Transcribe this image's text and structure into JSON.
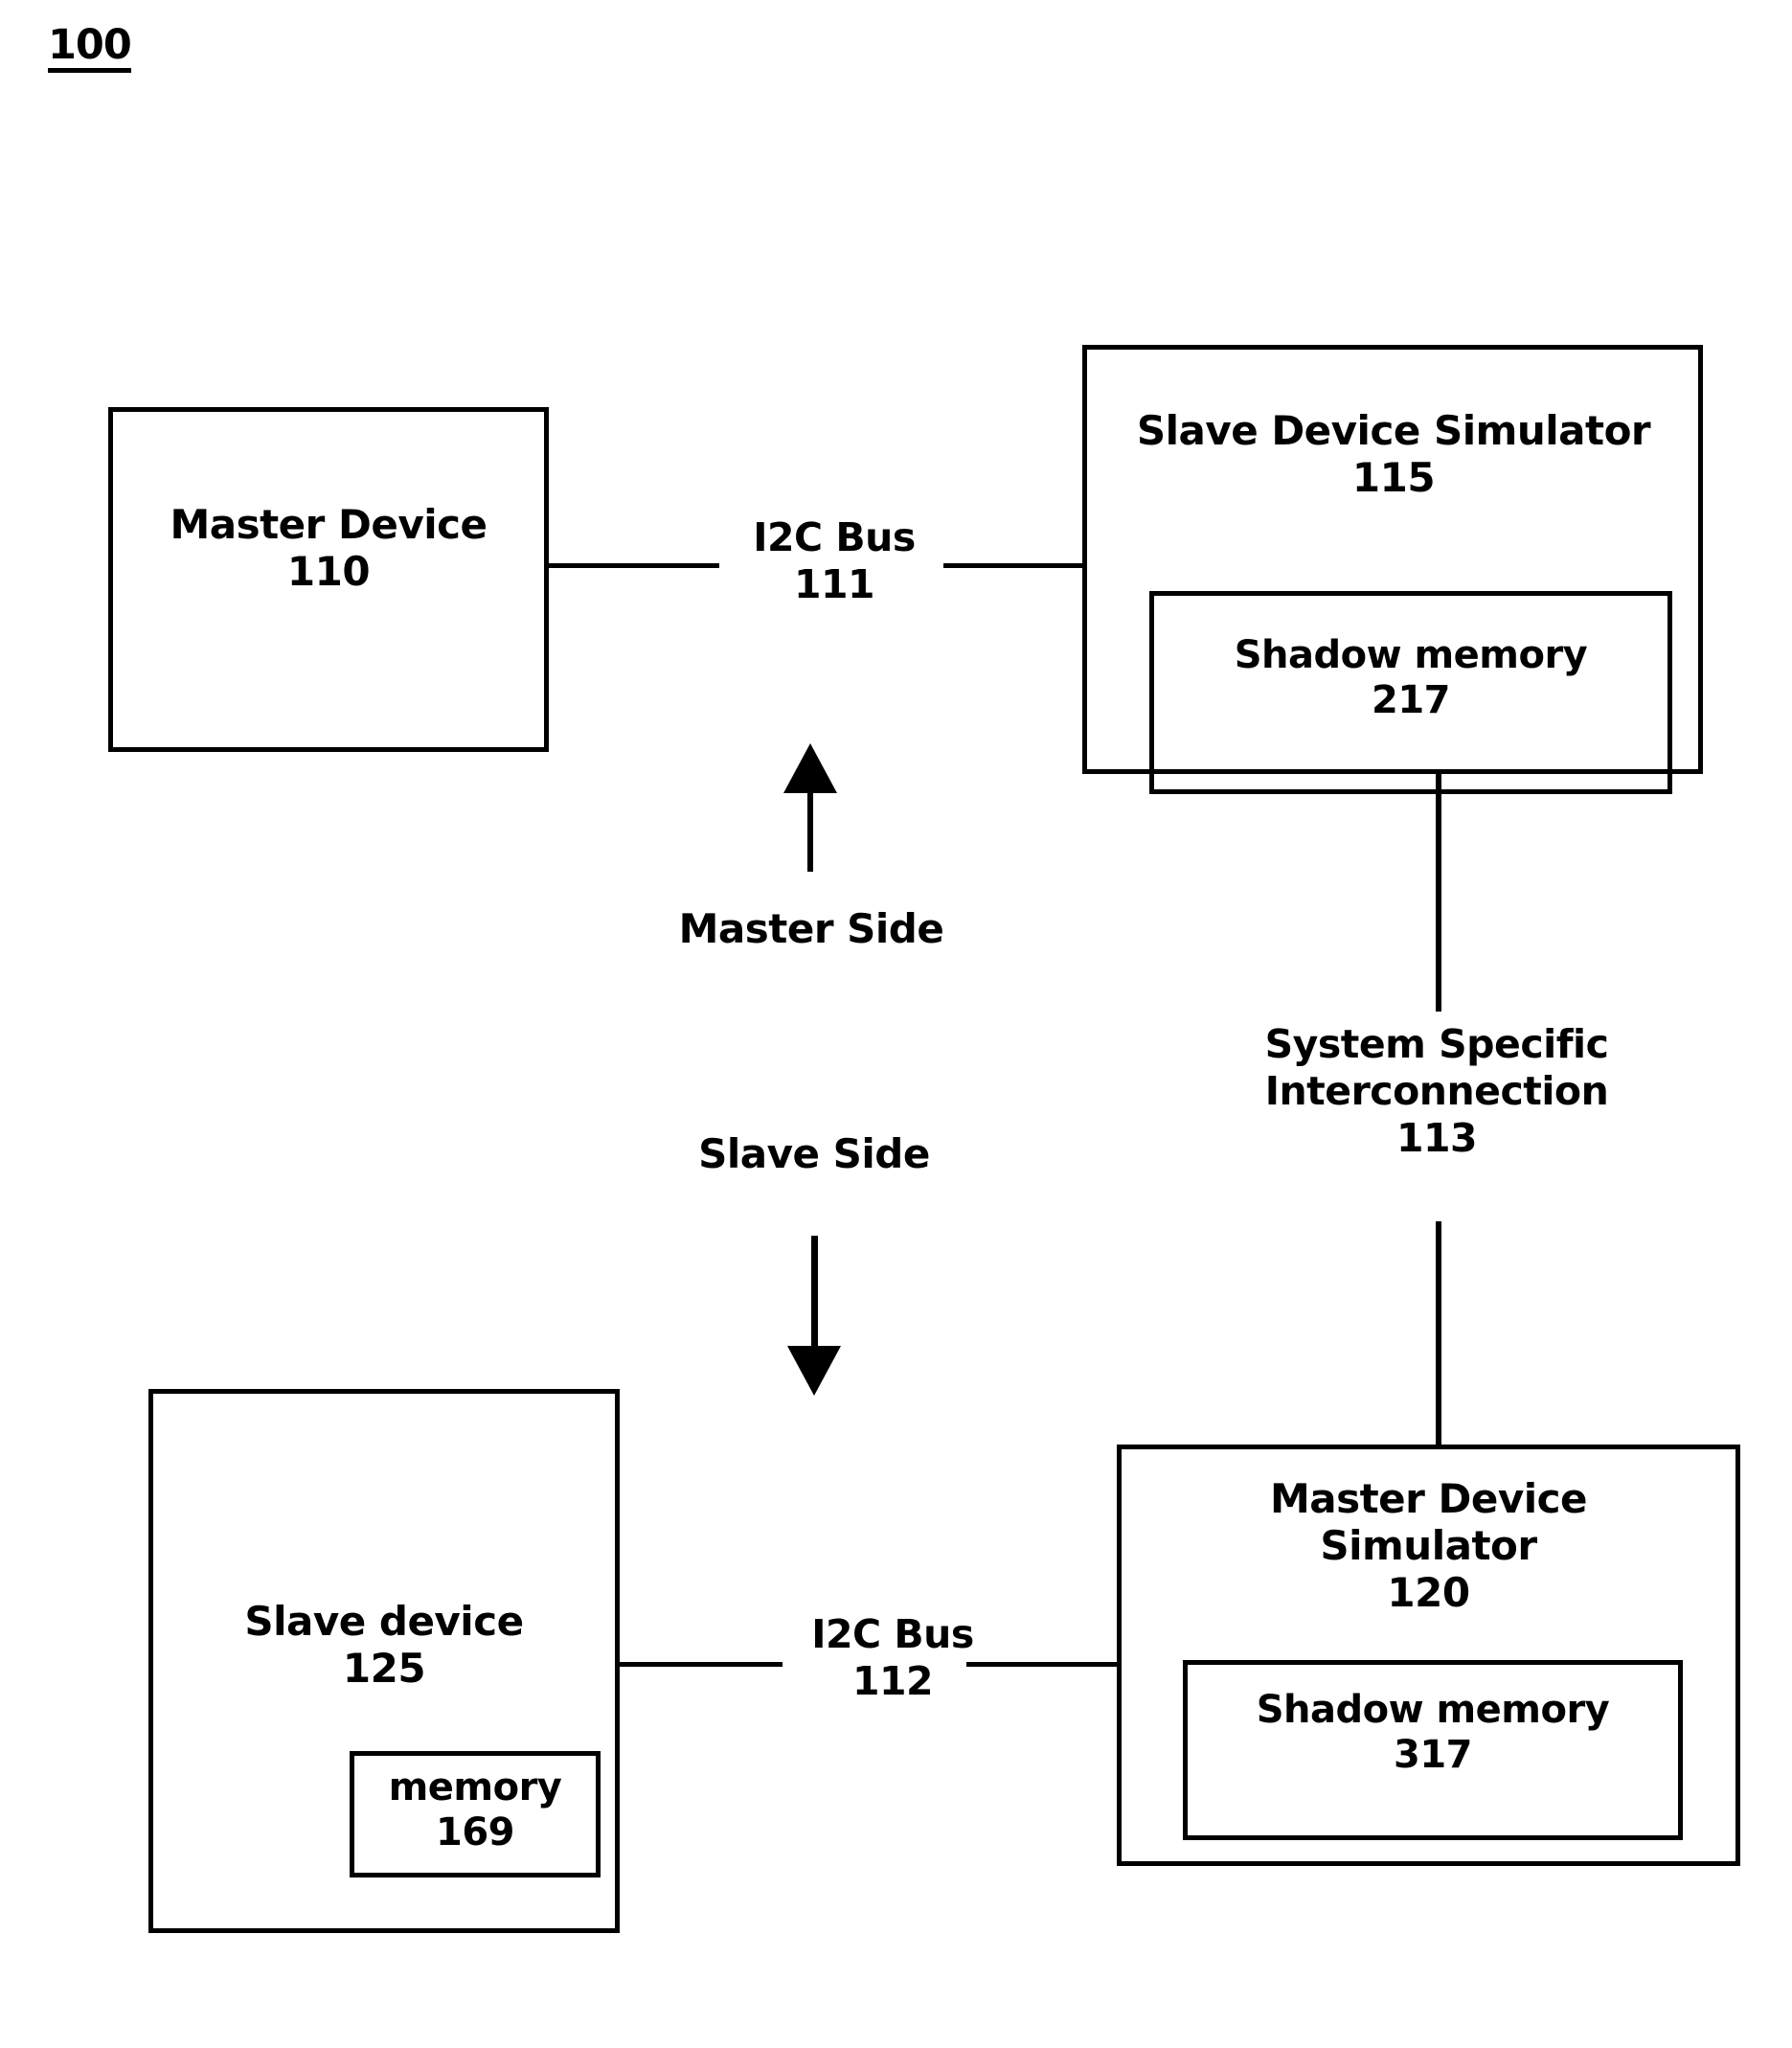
{
  "figure": {
    "number": "100"
  },
  "blocks": {
    "master_device": {
      "name": "Master Device",
      "ref": "110",
      "label": "Master Device\n110"
    },
    "slave_device_simulator": {
      "name": "Slave Device Simulator",
      "ref": "115",
      "label": "Slave Device Simulator\n115"
    },
    "shadow_memory_217": {
      "name": "Shadow memory",
      "ref": "217",
      "label": "Shadow memory\n217"
    },
    "slave_device": {
      "name": "Slave device",
      "ref": "125",
      "label": "Slave device\n125"
    },
    "memory_169": {
      "name": "memory",
      "ref": "169",
      "label": "memory\n169"
    },
    "master_device_simulator": {
      "name": "Master Device Simulator",
      "ref": "120",
      "label": "Master Device\nSimulator\n120"
    },
    "shadow_memory_317": {
      "name": "Shadow memory",
      "ref": "317",
      "label": "Shadow memory\n317"
    }
  },
  "connections": {
    "i2c_bus_111": {
      "name": "I2C Bus",
      "ref": "111",
      "label": "I2C Bus\n111"
    },
    "i2c_bus_112": {
      "name": "I2C Bus",
      "ref": "112",
      "label": "I2C Bus\n112"
    },
    "system_specific_interconnection_113": {
      "name": "System Specific Interconnection",
      "ref": "113",
      "label": "System Specific\nInterconnection\n113"
    }
  },
  "annotations": {
    "master_side": "Master Side",
    "slave_side": "Slave Side"
  },
  "colors": {
    "ink": "#000000",
    "paper": "#ffffff"
  }
}
